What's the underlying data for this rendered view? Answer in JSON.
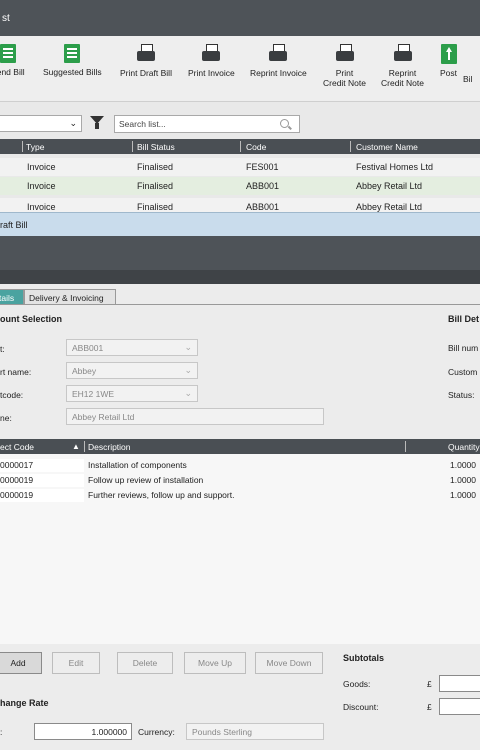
{
  "back_window": {
    "title": "st",
    "toolbar": [
      {
        "label": "nend Bill",
        "icon": "amend-bill-icon"
      },
      {
        "label": "Suggested Bills",
        "icon": "suggested-bills-icon"
      },
      {
        "label": "Print Draft Bill",
        "icon": "printer-icon"
      },
      {
        "label": "Print Invoice",
        "icon": "printer-icon"
      },
      {
        "label": "Reprint Invoice",
        "icon": "printer-icon"
      },
      {
        "label": "Print\nCredit Note",
        "icon": "printer-icon"
      },
      {
        "label": "Reprint\nCredit Note",
        "icon": "printer-icon"
      },
      {
        "label": "Post",
        "icon": "post-icon"
      },
      {
        "label": "Bil",
        "icon": ""
      }
    ],
    "search_placeholder": "Search list...",
    "columns": [
      "Type",
      "Bill Status",
      "Code",
      "Customer Name"
    ],
    "rows": [
      {
        "type": "Invoice",
        "status": "Finalised",
        "code": "FES001",
        "customer": "Festival Homes Ltd"
      },
      {
        "type": "Invoice",
        "status": "Finalised",
        "code": "ABB001",
        "customer": "Abbey Retail Ltd"
      },
      {
        "type": "Invoice",
        "status": "Finalised",
        "code": "ABB001",
        "customer": "Abbey Retail Ltd"
      }
    ]
  },
  "draft_window": {
    "title": "raft Bill",
    "tabs": [
      "tails",
      "Delivery & Invoicing"
    ],
    "account_section": {
      "title": "ount Selection",
      "fields": [
        {
          "label": "t:",
          "value": "ABB001"
        },
        {
          "label": "rt name:",
          "value": "Abbey"
        },
        {
          "label": "tcode:",
          "value": "EH12 1WE"
        },
        {
          "label": "ne:",
          "value": "Abbey Retail Ltd"
        }
      ]
    },
    "bill_details": {
      "title": "Bill Det",
      "labels": [
        "Bill num",
        "Custom",
        "Status:"
      ]
    },
    "lines": {
      "columns": [
        "ect Code",
        "Description",
        "Quantity"
      ],
      "rows": [
        {
          "code": "0000017",
          "description": "Installation of components",
          "quantity": "1.0000"
        },
        {
          "code": "0000019",
          "description": "Follow up review of installation",
          "quantity": "1.0000"
        },
        {
          "code": "0000019",
          "description": "Further reviews, follow up and support.",
          "quantity": "1.0000"
        }
      ]
    },
    "buttons": {
      "add": "Add",
      "edit": "Edit",
      "delete": "Delete",
      "move_up": "Move Up",
      "move_down": "Move Down"
    },
    "subtotals": {
      "title": "Subtotals",
      "goods_label": "Goods:",
      "discount_label": "Discount:",
      "currency_symbol": "£"
    },
    "exchange": {
      "title": "hange Rate",
      "rate_label": ":",
      "rate_value": "1.000000",
      "currency_label": "Currency:",
      "currency_value": "Pounds Sterling"
    }
  }
}
